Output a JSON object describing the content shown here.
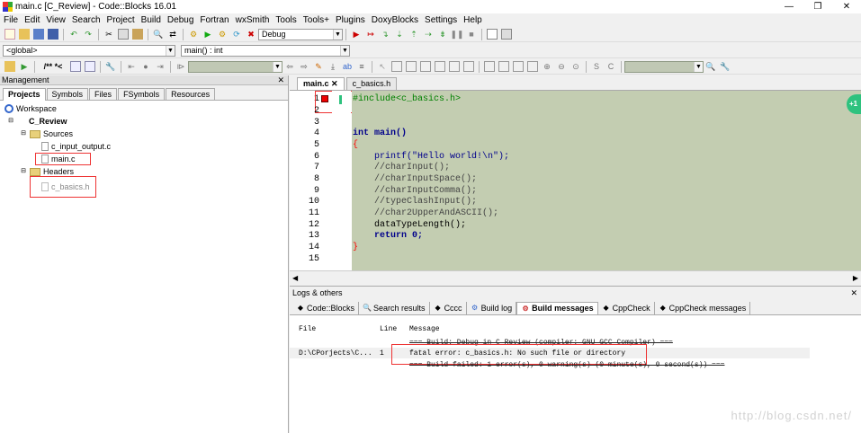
{
  "window": {
    "title": "main.c [C_Review] - Code::Blocks 16.01",
    "controls": [
      "—",
      "❐",
      "✕"
    ]
  },
  "menu": [
    "File",
    "Edit",
    "View",
    "Search",
    "Project",
    "Build",
    "Debug",
    "Fortran",
    "wxSmith",
    "Tools",
    "Tools+",
    "Plugins",
    "DoxyBlocks",
    "Settings",
    "Help"
  ],
  "toolbar": {
    "build_target": "Debug",
    "scope": "<global>",
    "function": "main() : int",
    "doxy_comment": "/** *<"
  },
  "management": {
    "title": "Management",
    "tabs": [
      "Projects",
      "Symbols",
      "Files",
      "FSymbols",
      "Resources"
    ],
    "active_tab": "Projects",
    "tree": {
      "workspace": "Workspace",
      "project": "C_Review",
      "sources": "Sources",
      "source_files": [
        "c_input_output.c",
        "main.c"
      ],
      "headers": "Headers",
      "header_files": [
        "c_basics.h"
      ]
    }
  },
  "editor": {
    "tabs": [
      {
        "label": "main.c",
        "close": "✕",
        "active": true
      },
      {
        "label": "c_basics.h",
        "close": "",
        "active": false
      }
    ],
    "lines": [
      "#include<c_basics.h>",
      "",
      "",
      "int main()",
      "{",
      "    printf(\"Hello world!\\n\");",
      "    //charInput();",
      "    //charInputSpace();",
      "    //charInputComma();",
      "    //typeClashInput();",
      "    //char2UpperAndASCII();",
      "    dataTypeLength();",
      "    return 0;",
      "}",
      ""
    ],
    "line_numbers": [
      "1",
      "2",
      "3",
      "4",
      "5",
      "6",
      "7",
      "8",
      "9",
      "10",
      "11",
      "12",
      "13",
      "14",
      "15"
    ],
    "badge": "+1",
    "colors": {
      "background": "#c3cdb1",
      "keyword": "#00008b",
      "string": "#0000ff",
      "comment": "#555555",
      "preproc": "#008000",
      "number": "#ff0000",
      "brace": "#ff0000"
    }
  },
  "logs": {
    "title": "Logs & others",
    "tabs": [
      {
        "label": "Code::Blocks",
        "icon": "code-blocks-icon",
        "active": false
      },
      {
        "label": "Search results",
        "icon": "search-icon",
        "active": false
      },
      {
        "label": "Cccc",
        "icon": "cccc-icon",
        "active": false
      },
      {
        "label": "Build log",
        "icon": "build-log-icon",
        "active": false
      },
      {
        "label": "Build messages",
        "icon": "build-messages-icon",
        "active": true
      },
      {
        "label": "CppCheck",
        "icon": "cppcheck-icon",
        "active": false
      },
      {
        "label": "CppCheck messages",
        "icon": "cppcheck-messages-icon",
        "active": false
      }
    ],
    "columns": [
      "File",
      "Line",
      "Message"
    ],
    "rows": [
      {
        "file": "",
        "line": "",
        "message": "=== Build: Debug in C_Review (compiler: GNU GCC Compiler) ===",
        "strike": true
      },
      {
        "file": "D:\\CPorjects\\C...",
        "line": "1",
        "message": "fatal error: c_basics.h: No such file or directory",
        "strike": false
      },
      {
        "file": "",
        "line": "",
        "message": "=== Build failed: 1 error(s), 0 warning(s) (0 minute(s), 0 second(s)) ===",
        "strike": true
      }
    ]
  },
  "watermark": "http://blog.csdn.net/"
}
